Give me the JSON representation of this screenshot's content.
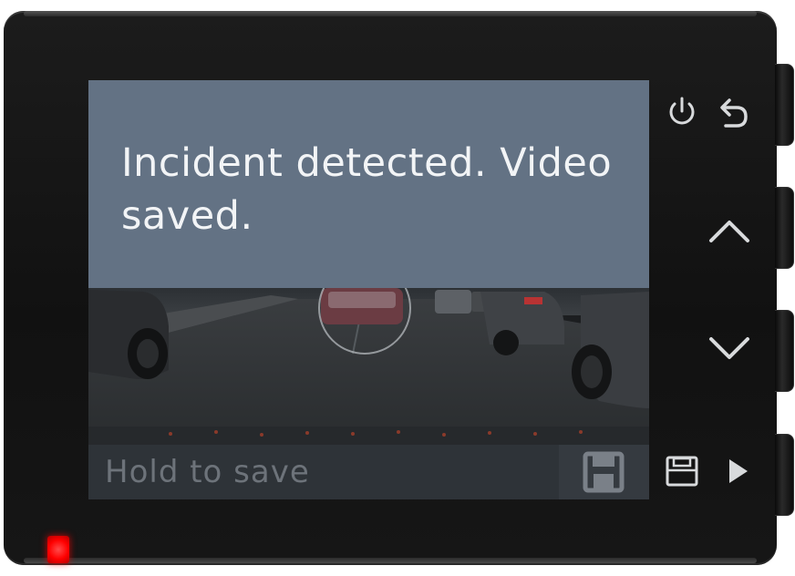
{
  "alert": {
    "message": "Incident detected. Video saved."
  },
  "bottom_bar": {
    "hold_label": "Hold to save"
  },
  "icons": {
    "power": "power-icon",
    "back": "back-arrow-icon",
    "up": "chevron-up-icon",
    "down": "chevron-down-icon",
    "save": "save-icon",
    "play": "play-icon"
  },
  "colors": {
    "alert_panel": "#637284",
    "alert_text": "#f2f4f6",
    "bottom_bar": "#2e3338",
    "hold_text": "#6d737a",
    "led": "#ff0000",
    "device_body": "#141414"
  }
}
